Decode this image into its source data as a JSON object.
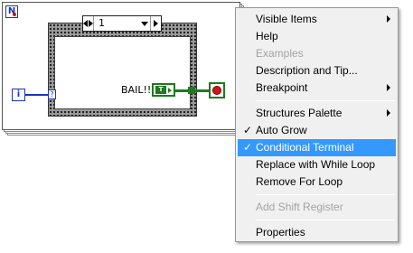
{
  "diagram": {
    "count_terminal": "N",
    "iteration_terminal": "i",
    "tunnel_marker": "?",
    "case_selector_value": "1",
    "bail_label": "BAIL!!!",
    "bool_constant_label": "T"
  },
  "context_menu": {
    "items": [
      {
        "label": "Visible Items",
        "submenu": true
      },
      {
        "label": "Help"
      },
      {
        "label": "Examples",
        "disabled": true
      },
      {
        "label": "Description and Tip..."
      },
      {
        "label": "Breakpoint",
        "submenu": true
      },
      {
        "label": "Structures Palette",
        "submenu": true
      },
      {
        "label": "Auto Grow",
        "checked": true
      },
      {
        "label": "Conditional Terminal",
        "checked": true,
        "highlighted": true
      },
      {
        "label": "Replace with While Loop"
      },
      {
        "label": "Remove For Loop"
      },
      {
        "label": "Add Shift Register",
        "disabled": true
      },
      {
        "label": "Properties"
      }
    ],
    "check_glyph": "✓"
  },
  "colors": {
    "menu_highlight": "#3399ff",
    "boolean_wire": "#1f7a1f",
    "numeric_terminal": "#1a35b8",
    "stop_red": "#d31414"
  }
}
